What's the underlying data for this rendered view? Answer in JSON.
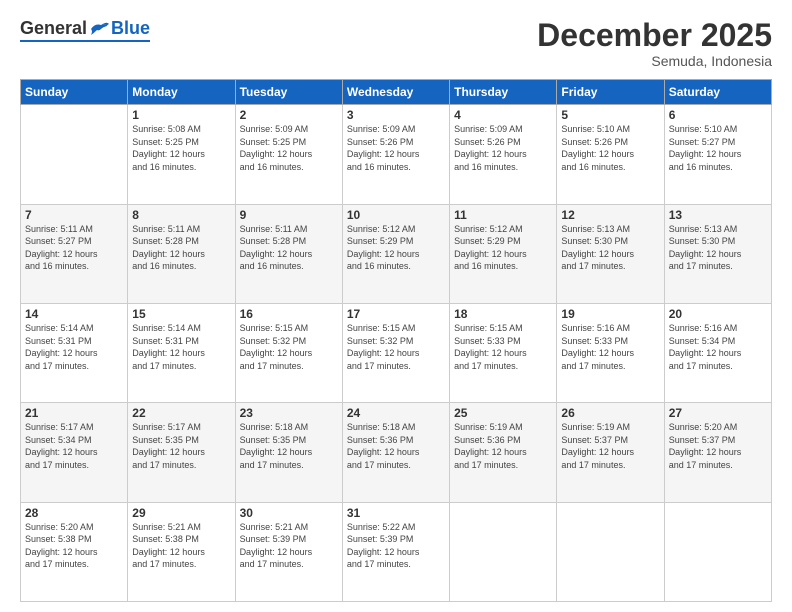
{
  "logo": {
    "general": "General",
    "blue": "Blue"
  },
  "title": "December 2025",
  "subtitle": "Semuda, Indonesia",
  "days_of_week": [
    "Sunday",
    "Monday",
    "Tuesday",
    "Wednesday",
    "Thursday",
    "Friday",
    "Saturday"
  ],
  "weeks": [
    [
      {
        "day": "",
        "info": ""
      },
      {
        "day": "1",
        "info": "Sunrise: 5:08 AM\nSunset: 5:25 PM\nDaylight: 12 hours\nand 16 minutes."
      },
      {
        "day": "2",
        "info": "Sunrise: 5:09 AM\nSunset: 5:25 PM\nDaylight: 12 hours\nand 16 minutes."
      },
      {
        "day": "3",
        "info": "Sunrise: 5:09 AM\nSunset: 5:26 PM\nDaylight: 12 hours\nand 16 minutes."
      },
      {
        "day": "4",
        "info": "Sunrise: 5:09 AM\nSunset: 5:26 PM\nDaylight: 12 hours\nand 16 minutes."
      },
      {
        "day": "5",
        "info": "Sunrise: 5:10 AM\nSunset: 5:26 PM\nDaylight: 12 hours\nand 16 minutes."
      },
      {
        "day": "6",
        "info": "Sunrise: 5:10 AM\nSunset: 5:27 PM\nDaylight: 12 hours\nand 16 minutes."
      }
    ],
    [
      {
        "day": "7",
        "info": "Sunrise: 5:11 AM\nSunset: 5:27 PM\nDaylight: 12 hours\nand 16 minutes."
      },
      {
        "day": "8",
        "info": "Sunrise: 5:11 AM\nSunset: 5:28 PM\nDaylight: 12 hours\nand 16 minutes."
      },
      {
        "day": "9",
        "info": "Sunrise: 5:11 AM\nSunset: 5:28 PM\nDaylight: 12 hours\nand 16 minutes."
      },
      {
        "day": "10",
        "info": "Sunrise: 5:12 AM\nSunset: 5:29 PM\nDaylight: 12 hours\nand 16 minutes."
      },
      {
        "day": "11",
        "info": "Sunrise: 5:12 AM\nSunset: 5:29 PM\nDaylight: 12 hours\nand 16 minutes."
      },
      {
        "day": "12",
        "info": "Sunrise: 5:13 AM\nSunset: 5:30 PM\nDaylight: 12 hours\nand 17 minutes."
      },
      {
        "day": "13",
        "info": "Sunrise: 5:13 AM\nSunset: 5:30 PM\nDaylight: 12 hours\nand 17 minutes."
      }
    ],
    [
      {
        "day": "14",
        "info": "Sunrise: 5:14 AM\nSunset: 5:31 PM\nDaylight: 12 hours\nand 17 minutes."
      },
      {
        "day": "15",
        "info": "Sunrise: 5:14 AM\nSunset: 5:31 PM\nDaylight: 12 hours\nand 17 minutes."
      },
      {
        "day": "16",
        "info": "Sunrise: 5:15 AM\nSunset: 5:32 PM\nDaylight: 12 hours\nand 17 minutes."
      },
      {
        "day": "17",
        "info": "Sunrise: 5:15 AM\nSunset: 5:32 PM\nDaylight: 12 hours\nand 17 minutes."
      },
      {
        "day": "18",
        "info": "Sunrise: 5:15 AM\nSunset: 5:33 PM\nDaylight: 12 hours\nand 17 minutes."
      },
      {
        "day": "19",
        "info": "Sunrise: 5:16 AM\nSunset: 5:33 PM\nDaylight: 12 hours\nand 17 minutes."
      },
      {
        "day": "20",
        "info": "Sunrise: 5:16 AM\nSunset: 5:34 PM\nDaylight: 12 hours\nand 17 minutes."
      }
    ],
    [
      {
        "day": "21",
        "info": "Sunrise: 5:17 AM\nSunset: 5:34 PM\nDaylight: 12 hours\nand 17 minutes."
      },
      {
        "day": "22",
        "info": "Sunrise: 5:17 AM\nSunset: 5:35 PM\nDaylight: 12 hours\nand 17 minutes."
      },
      {
        "day": "23",
        "info": "Sunrise: 5:18 AM\nSunset: 5:35 PM\nDaylight: 12 hours\nand 17 minutes."
      },
      {
        "day": "24",
        "info": "Sunrise: 5:18 AM\nSunset: 5:36 PM\nDaylight: 12 hours\nand 17 minutes."
      },
      {
        "day": "25",
        "info": "Sunrise: 5:19 AM\nSunset: 5:36 PM\nDaylight: 12 hours\nand 17 minutes."
      },
      {
        "day": "26",
        "info": "Sunrise: 5:19 AM\nSunset: 5:37 PM\nDaylight: 12 hours\nand 17 minutes."
      },
      {
        "day": "27",
        "info": "Sunrise: 5:20 AM\nSunset: 5:37 PM\nDaylight: 12 hours\nand 17 minutes."
      }
    ],
    [
      {
        "day": "28",
        "info": "Sunrise: 5:20 AM\nSunset: 5:38 PM\nDaylight: 12 hours\nand 17 minutes."
      },
      {
        "day": "29",
        "info": "Sunrise: 5:21 AM\nSunset: 5:38 PM\nDaylight: 12 hours\nand 17 minutes."
      },
      {
        "day": "30",
        "info": "Sunrise: 5:21 AM\nSunset: 5:39 PM\nDaylight: 12 hours\nand 17 minutes."
      },
      {
        "day": "31",
        "info": "Sunrise: 5:22 AM\nSunset: 5:39 PM\nDaylight: 12 hours\nand 17 minutes."
      },
      {
        "day": "",
        "info": ""
      },
      {
        "day": "",
        "info": ""
      },
      {
        "day": "",
        "info": ""
      }
    ]
  ]
}
